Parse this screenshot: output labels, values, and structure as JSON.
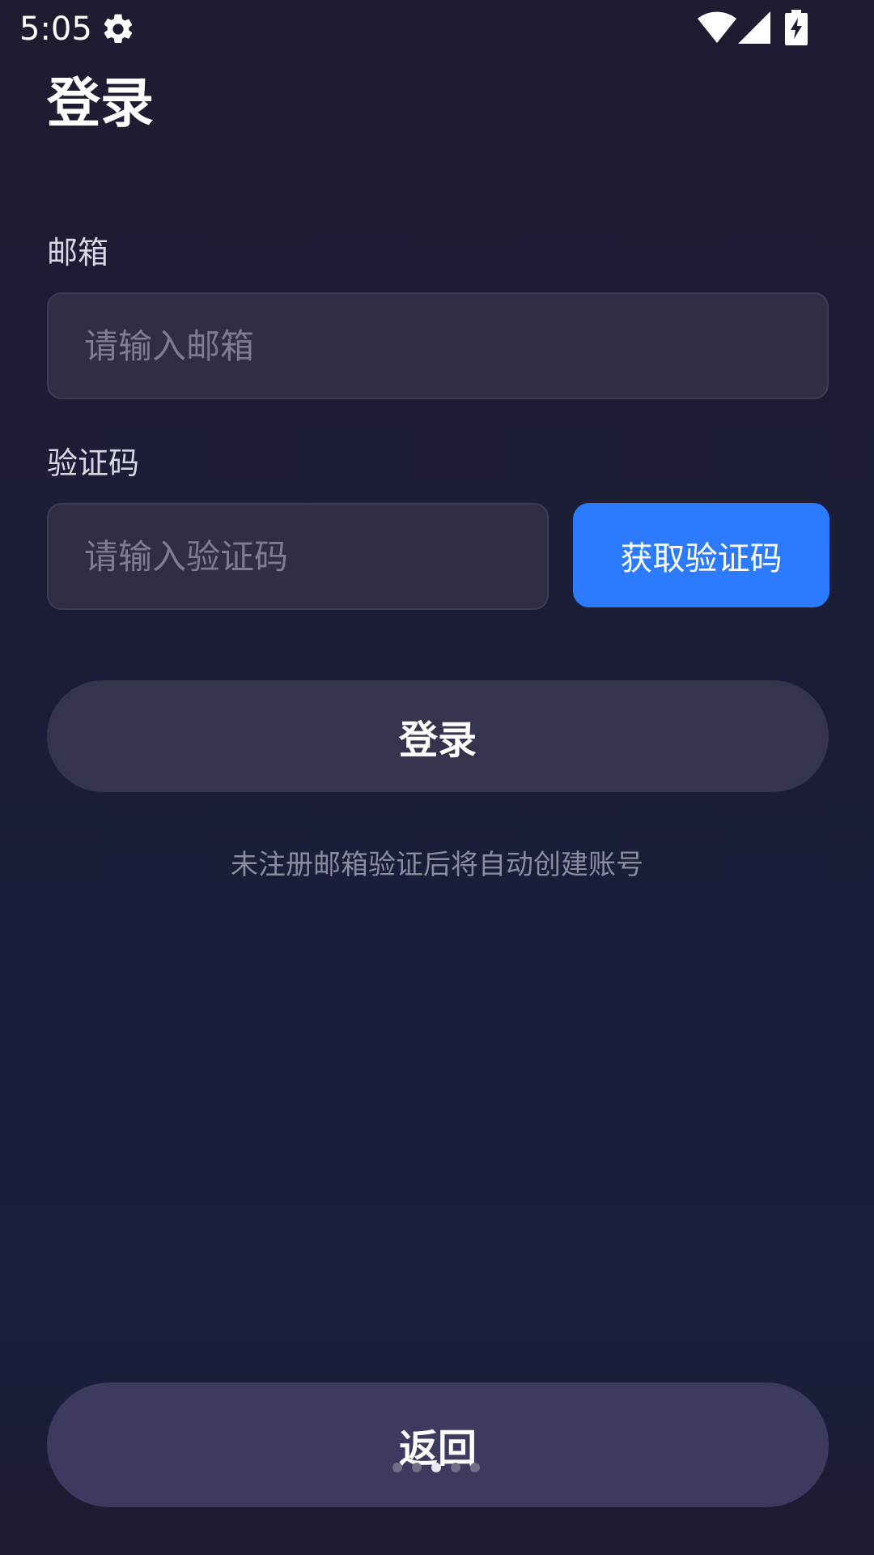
{
  "status_bar": {
    "time": "5:05",
    "icons": [
      "gear-icon",
      "wifi-icon",
      "signal-icon",
      "battery-charging-icon"
    ]
  },
  "page": {
    "title": "登录"
  },
  "email_field": {
    "label": "邮箱",
    "placeholder": "请输入邮箱",
    "value": ""
  },
  "code_field": {
    "label": "验证码",
    "placeholder": "请输入验证码",
    "value": ""
  },
  "buttons": {
    "get_code": "获取验证码",
    "login": "登录",
    "back": "返回"
  },
  "hint": "未注册邮箱验证后将自动创建账号",
  "pager": {
    "count": 5,
    "active_index": 2
  },
  "colors": {
    "accent": "#2c7bff",
    "background": "#1b1d38",
    "input_bg": "#2e2e45",
    "login_button_bg": "#34354d",
    "back_button_bg": "#3c3a5e"
  }
}
